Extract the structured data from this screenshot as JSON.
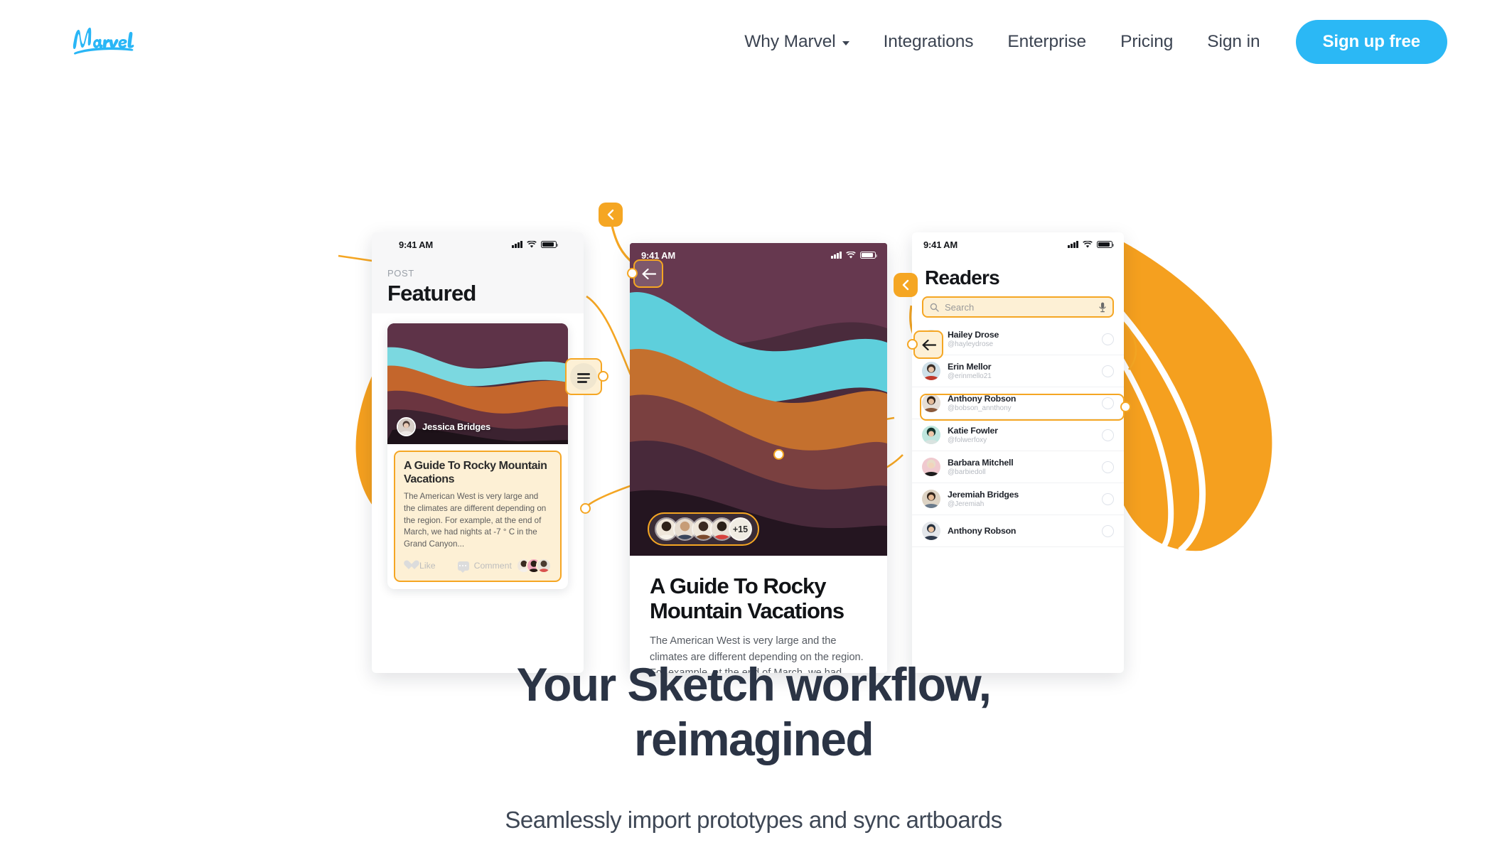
{
  "brand": {
    "name": "Marvel",
    "logo_color": "#29b6f6",
    "accent_blue": "#2bb8f5",
    "accent_orange": "#f5a623"
  },
  "nav": {
    "items": [
      {
        "label": "Why Marvel",
        "has_dropdown": true
      },
      {
        "label": "Integrations",
        "has_dropdown": false
      },
      {
        "label": "Enterprise",
        "has_dropdown": false
      },
      {
        "label": "Pricing",
        "has_dropdown": false
      },
      {
        "label": "Sign in",
        "has_dropdown": false
      }
    ],
    "cta": "Sign up free"
  },
  "hero": {
    "headline_line1": "Your Sketch workflow,",
    "headline_line2": "reimagined",
    "subhead": "Seamlessly import prototypes and sync artboards"
  },
  "phone1": {
    "status_time": "9:41 AM",
    "kicker": "POST",
    "title": "Featured",
    "author": "Jessica Bridges",
    "card_title": "A Guide To Rocky Mountain Vacations",
    "card_text": "The American West is very large and the climates are different depending on the region. For example, at the end of March, we had nights at -7 ° C in the Grand Canyon...",
    "like_label": "Like",
    "comment_label": "Comment"
  },
  "phone2": {
    "status_time": "9:41 AM",
    "title": "A Guide To Rocky Mountain Vacations",
    "text": "The American West is very large and the climates are different depending on the region. For example, at the end of March, we had nights",
    "avatar_overflow": "+15"
  },
  "phone3": {
    "status_time": "9:41 AM",
    "title": "Readers",
    "search_placeholder": "Search",
    "readers": [
      {
        "name": "Hailey Drose",
        "handle": "@hayleydrose"
      },
      {
        "name": "Erin Mellor",
        "handle": "@erinmello21"
      },
      {
        "name": "Anthony Robson",
        "handle": "@bobson_annthony"
      },
      {
        "name": "Katie Fowler",
        "handle": "@folwerfoxy"
      },
      {
        "name": "Barbara Mitchell",
        "handle": "@barbiedoll"
      },
      {
        "name": "Jeremiah Bridges",
        "handle": "@Jeremiah"
      },
      {
        "name": "Anthony Robson",
        "handle": ""
      }
    ]
  }
}
